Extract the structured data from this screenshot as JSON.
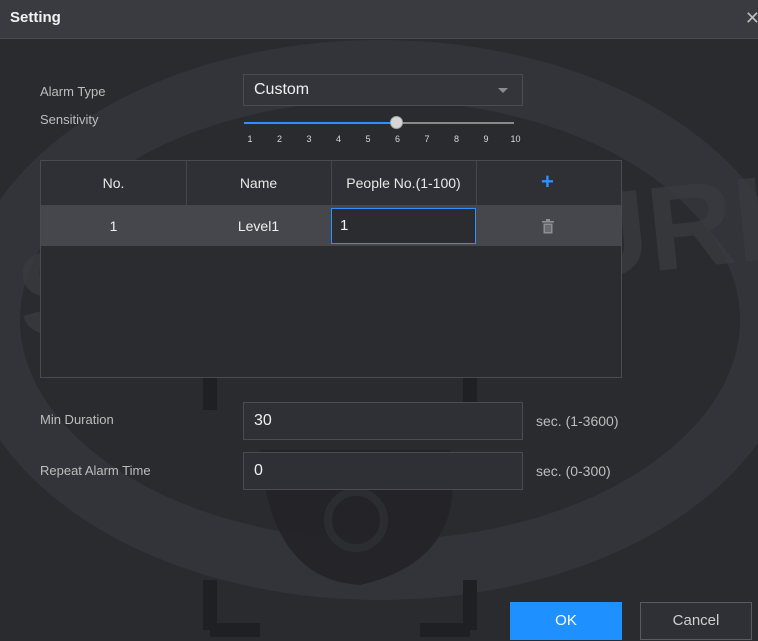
{
  "dialog": {
    "title": "Setting"
  },
  "alarm_type": {
    "label": "Alarm Type",
    "value": "Custom"
  },
  "sensitivity": {
    "label": "Sensitivity",
    "ticks": [
      "1",
      "2",
      "3",
      "4",
      "5",
      "6",
      "7",
      "8",
      "9",
      "10"
    ],
    "value": 6
  },
  "table": {
    "headers": {
      "no": "No.",
      "name": "Name",
      "people": "People No.(1-100)"
    },
    "rows": [
      {
        "no": "1",
        "name": "Level1",
        "people": "1"
      }
    ]
  },
  "min_duration": {
    "label": "Min Duration",
    "value": "30",
    "unit": "sec. (1-3600)"
  },
  "repeat_alarm": {
    "label": "Repeat Alarm Time",
    "value": "0",
    "unit": "sec. (0-300)"
  },
  "buttons": {
    "ok": "OK",
    "cancel": "Cancel"
  },
  "watermark": "SAM SECURI",
  "colors": {
    "accent": "#1e90ff",
    "background": "#2a2b2f"
  }
}
